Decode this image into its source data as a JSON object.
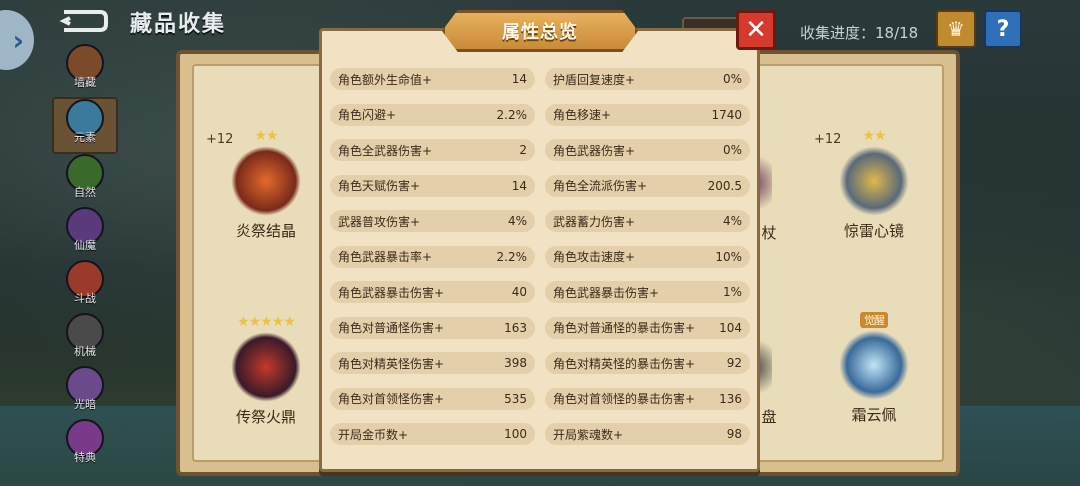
{
  "header": {
    "title": "藏品收集",
    "progress_text": "收集进度：18/18",
    "crown_icon": "crown-icon",
    "help_label": "?"
  },
  "side_tab_label": "›",
  "categories": [
    {
      "label": "墙藏"
    },
    {
      "label": "元素"
    },
    {
      "label": "自然"
    },
    {
      "label": "仙魔"
    },
    {
      "label": "斗战"
    },
    {
      "label": "机械"
    },
    {
      "label": "光暗"
    },
    {
      "label": "特典"
    }
  ],
  "collection": [
    {
      "name": "炎祭结晶",
      "stars": "★★",
      "plus": "+12"
    },
    {
      "name": "惊雷心镜",
      "stars": "★★",
      "plus": "+12"
    },
    {
      "name": "传祭火鼎",
      "stars": "★★★★★"
    },
    {
      "name": "霜云佩",
      "badge": "觉醒"
    },
    {
      "name": "杖"
    },
    {
      "name": "盘"
    }
  ],
  "modal": {
    "title": "属性总览",
    "close_label": "✕",
    "stats": [
      [
        {
          "label": "角色额外生命值+",
          "value": "14"
        },
        {
          "label": "护盾回复速度+",
          "value": "0%"
        }
      ],
      [
        {
          "label": "角色闪避+",
          "value": "2.2%"
        },
        {
          "label": "角色移速+",
          "value": "1740"
        }
      ],
      [
        {
          "label": "角色全武器伤害+",
          "value": "2"
        },
        {
          "label": "角色武器伤害+",
          "value": "0%"
        }
      ],
      [
        {
          "label": "角色天赋伤害+",
          "value": "14"
        },
        {
          "label": "角色全流派伤害+",
          "value": "200.5"
        }
      ],
      [
        {
          "label": "武器普攻伤害+",
          "value": "4%"
        },
        {
          "label": "武器蓄力伤害+",
          "value": "4%"
        }
      ],
      [
        {
          "label": "角色武器暴击率+",
          "value": "2.2%"
        },
        {
          "label": "角色攻击速度+",
          "value": "10%"
        }
      ],
      [
        {
          "label": "角色武器暴击伤害+",
          "value": "40"
        },
        {
          "label": "角色武器暴击伤害+",
          "value": "1%"
        }
      ],
      [
        {
          "label": "角色对普通怪伤害+",
          "value": "163"
        },
        {
          "label": "角色对普通怪的暴击伤害+",
          "value": "104"
        }
      ],
      [
        {
          "label": "角色对精英怪伤害+",
          "value": "398"
        },
        {
          "label": "角色对精英怪的暴击伤害+",
          "value": "92"
        }
      ],
      [
        {
          "label": "角色对首领怪伤害+",
          "value": "535"
        },
        {
          "label": "角色对首领怪的暴击伤害+",
          "value": "136"
        }
      ],
      [
        {
          "label": "开局金币数+",
          "value": "100"
        },
        {
          "label": "开局紫魂数+",
          "value": "98"
        }
      ]
    ]
  }
}
